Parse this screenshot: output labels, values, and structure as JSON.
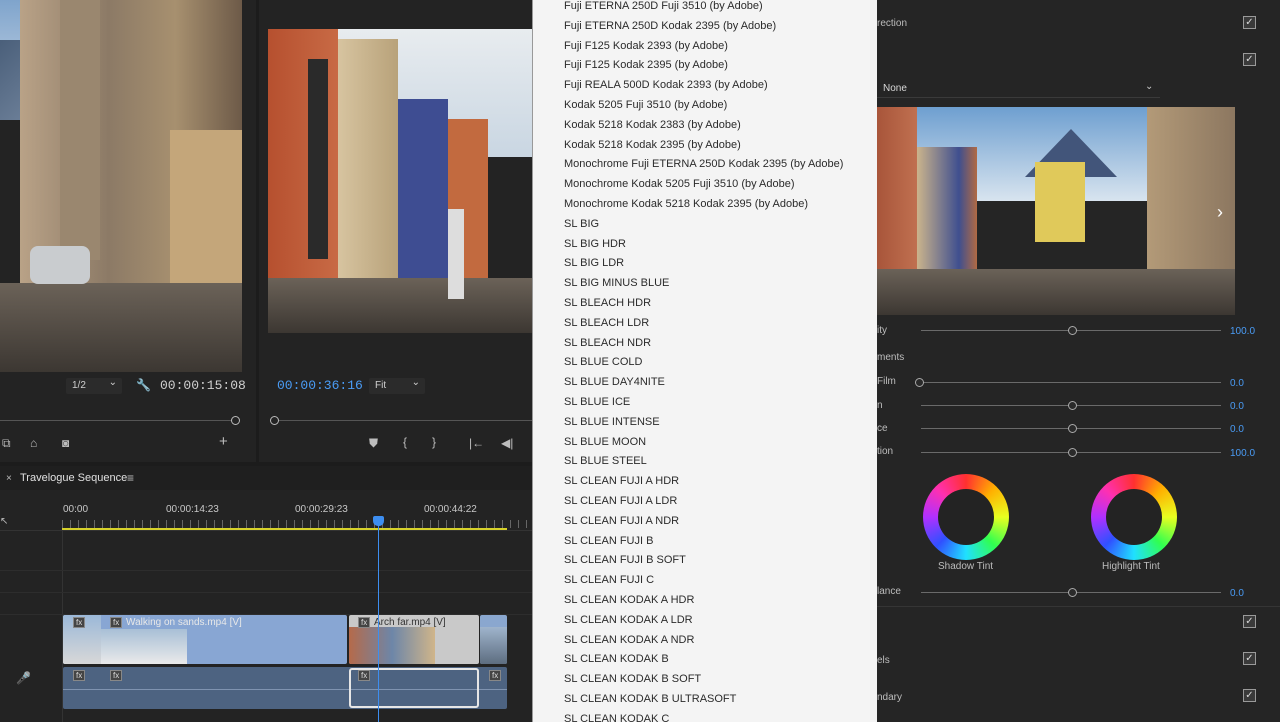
{
  "source_monitor": {
    "resolution": "1/2",
    "timecode": "00:00:15:08"
  },
  "program_monitor": {
    "timecode": "00:00:36:16",
    "fit": "Fit"
  },
  "timeline": {
    "tab_label": "Travelogue Sequence",
    "ruler": [
      "00:00",
      "00:00:14:23",
      "00:00:29:23",
      "00:00:44:22"
    ],
    "clips": [
      {
        "label": "Walking on sands.mp4 [V]"
      },
      {
        "label": "Arch far.mp4 [V]"
      }
    ],
    "fx_badge": "fx"
  },
  "lut_menu": {
    "items": [
      "Fuji ETERNA 250D Fuji 3510 (by Adobe)",
      "Fuji ETERNA 250D Kodak 2395 (by Adobe)",
      "Fuji F125 Kodak 2393 (by Adobe)",
      "Fuji F125 Kodak 2395 (by Adobe)",
      "Fuji REALA 500D Kodak 2393 (by Adobe)",
      "Kodak 5205 Fuji 3510 (by Adobe)",
      "Kodak 5218 Kodak 2383 (by Adobe)",
      "Kodak 5218 Kodak 2395 (by Adobe)",
      "Monochrome Fuji ETERNA 250D Kodak 2395 (by Adobe)",
      "Monochrome Kodak 5205 Fuji 3510 (by Adobe)",
      "Monochrome Kodak 5218 Kodak 2395 (by Adobe)",
      "SL BIG",
      "SL BIG HDR",
      "SL BIG LDR",
      "SL BIG MINUS BLUE",
      "SL BLEACH HDR",
      "SL BLEACH LDR",
      "SL BLEACH NDR",
      "SL BLUE COLD",
      "SL BLUE DAY4NITE",
      "SL BLUE ICE",
      "SL BLUE INTENSE",
      "SL BLUE MOON",
      "SL BLUE STEEL",
      "SL CLEAN FUJI A HDR",
      "SL CLEAN FUJI A LDR",
      "SL CLEAN FUJI A NDR",
      "SL CLEAN FUJI B",
      "SL CLEAN FUJI B SOFT",
      "SL CLEAN FUJI C",
      "SL CLEAN KODAK A HDR",
      "SL CLEAN KODAK A LDR",
      "SL CLEAN KODAK A NDR",
      "SL CLEAN KODAK B",
      "SL CLEAN KODAK B SOFT",
      "SL CLEAN KODAK B ULTRASOFT",
      "SL CLEAN KODAK C"
    ]
  },
  "lumetri": {
    "section_label_1": "rection",
    "look_value": "None",
    "sliders": [
      {
        "label": "ity",
        "value": "100.0",
        "pos": 0.5
      },
      {
        "label": "ments",
        "value": "",
        "pos": null
      },
      {
        "label": "Film",
        "value": "0.0",
        "pos": 0.0
      },
      {
        "label": "n",
        "value": "0.0",
        "pos": 0.5
      },
      {
        "label": "ce",
        "value": "0.0",
        "pos": 0.5
      },
      {
        "label": "tion",
        "value": "100.0",
        "pos": 0.5
      }
    ],
    "shadow_tint": "Shadow Tint",
    "highlight_tint": "Highlight Tint",
    "balance_label": "lance",
    "balance_value": "0.0",
    "bottom_labels": [
      "",
      "els",
      "ndary"
    ],
    "check_glyph": "✓",
    "colors": {
      "accent": "#4a9cf6",
      "playhead": "#3d8ef0"
    }
  }
}
